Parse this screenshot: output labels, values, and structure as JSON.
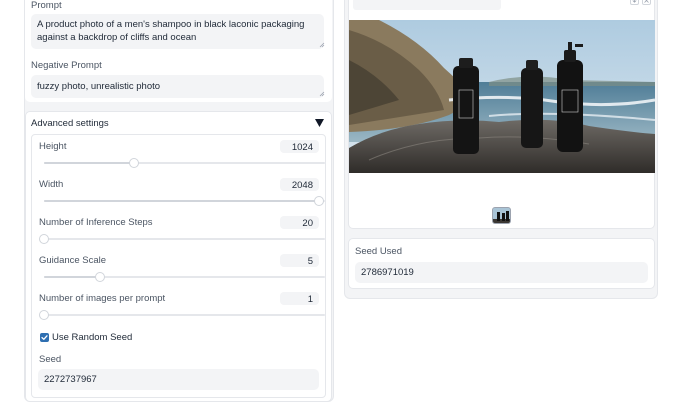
{
  "left": {
    "prompt": {
      "label": "Prompt",
      "value": "A product photo of a men's shampoo in black laconic packaging against a backdrop of cliffs and ocean"
    },
    "negative_prompt": {
      "label": "Negative Prompt",
      "value": "fuzzy photo, unrealistic photo"
    },
    "advanced": {
      "title": "Advanced settings",
      "sliders": [
        {
          "label": "Height",
          "value": "1024",
          "fraction": 0.32
        },
        {
          "label": "Width",
          "value": "2048",
          "fraction": 0.98
        },
        {
          "label": "Number of Inference Steps",
          "value": "20",
          "fraction": 0.0
        },
        {
          "label": "Guidance Scale",
          "value": "5",
          "fraction": 0.2
        },
        {
          "label": "Number of images per prompt",
          "value": "1",
          "fraction": 0.0
        }
      ],
      "random_seed": {
        "label": "Use Random Seed",
        "checked": true
      },
      "seed": {
        "label": "Seed",
        "value": "2272737967"
      }
    }
  },
  "right": {
    "seed_used": {
      "label": "Seed Used",
      "value": "2786971019"
    }
  },
  "colors": {
    "accent": "#2f6fb1",
    "panel_bg": "#f3f4f6",
    "border": "#e5e7eb"
  }
}
